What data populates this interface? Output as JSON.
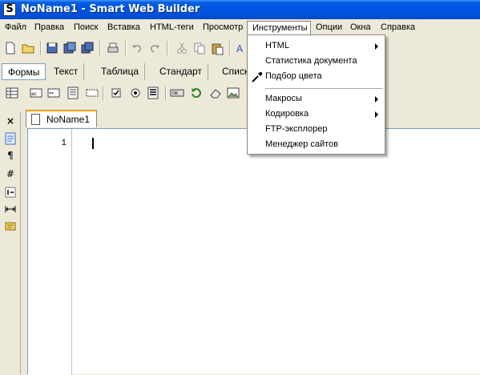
{
  "window": {
    "title": "NoName1 - Smart Web Builder",
    "app_icon": "S"
  },
  "menubar": {
    "items": [
      "Файл",
      "Правка",
      "Поиск",
      "Вставка",
      "HTML-теги",
      "Просмотр",
      "Инструменты",
      "Опции",
      "Окна",
      "Справка"
    ]
  },
  "category_tabs": [
    "Формы",
    "Текст",
    "Таблица",
    "Стандарт",
    "Списк"
  ],
  "document": {
    "tab_label": "NoName1",
    "line_number": "1"
  },
  "left_panel": {
    "close_glyph": "×",
    "pilcrow_glyph": "¶",
    "hash_glyph": "#"
  },
  "dropdown": {
    "items": [
      {
        "label": "HTML",
        "submenu": true
      },
      {
        "label": "Статистика документа",
        "submenu": false
      },
      {
        "label": "Подбор цвета",
        "submenu": false
      },
      {
        "label": "Макросы",
        "submenu": true
      },
      {
        "label": "Кодировка",
        "submenu": true
      },
      {
        "label": "FTP-эксплорер",
        "submenu": false
      },
      {
        "label": "Менеджер сайтов",
        "submenu": false
      }
    ]
  }
}
